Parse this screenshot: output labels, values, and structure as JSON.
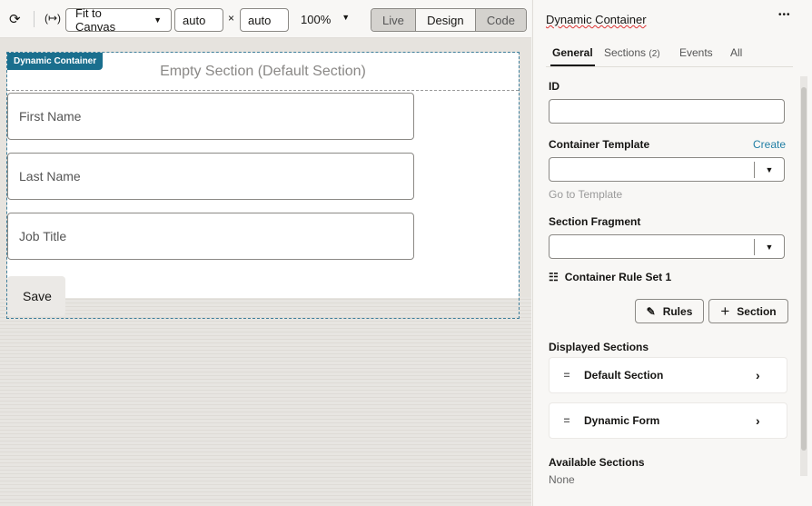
{
  "toolbar": {
    "fit": "Fit to Canvas",
    "width": "auto",
    "times": "×",
    "height": "auto",
    "zoom": "100%",
    "modes": [
      "Live",
      "Design",
      "Code"
    ]
  },
  "canvas": {
    "badge": "Dynamic Container",
    "empty": "Empty Section (Default Section)",
    "fields": [
      "First Name",
      "Last Name",
      "Job Title"
    ],
    "save": "Save"
  },
  "panel": {
    "title": "Dynamic Container",
    "more": "•••",
    "tabs": [
      "General",
      "Sections",
      "Events",
      "All"
    ],
    "sections_count": "(2)",
    "id_label": "ID",
    "template_label": "Container Template",
    "create": "Create",
    "goto": "Go to Template",
    "fragment_label": "Section Fragment",
    "ruleset": "Container Rule Set 1",
    "rules_btn": "Rules",
    "section_btn": "Section",
    "displayed": "Displayed Sections",
    "cards": [
      "Default Section",
      "Dynamic Form"
    ],
    "available": "Available Sections",
    "none": "None"
  }
}
